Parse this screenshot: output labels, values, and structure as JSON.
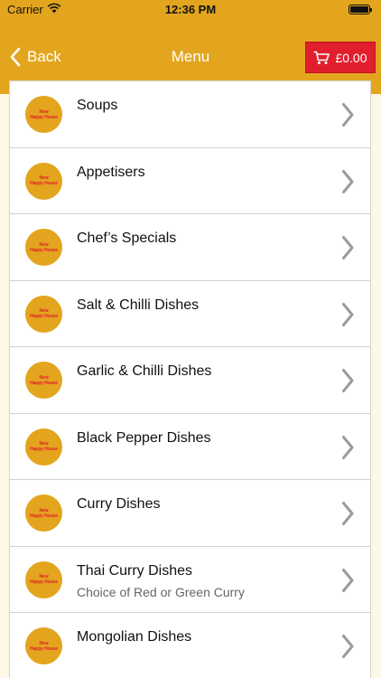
{
  "status_bar": {
    "carrier": "Carrier",
    "time": "12:36 PM",
    "icons": [
      "wifi-icon",
      "battery-icon"
    ]
  },
  "nav": {
    "back_label": "Back",
    "title": "Menu",
    "cart_total": "£0.00"
  },
  "logo_text": [
    "New",
    "Happy House"
  ],
  "colors": {
    "header": "#e3a51e",
    "cart_button": "#e01e2d",
    "background": "#fdf7e6",
    "logo_text": "#e0202a"
  },
  "categories": [
    {
      "title": "Soups",
      "subtitle": ""
    },
    {
      "title": "Appetisers",
      "subtitle": ""
    },
    {
      "title": "Chef’s Specials",
      "subtitle": ""
    },
    {
      "title": "Salt & Chilli Dishes",
      "subtitle": ""
    },
    {
      "title": "Garlic & Chilli Dishes",
      "subtitle": ""
    },
    {
      "title": "Black Pepper Dishes",
      "subtitle": ""
    },
    {
      "title": "Curry Dishes",
      "subtitle": ""
    },
    {
      "title": "Thai Curry Dishes",
      "subtitle": "Choice of Red or Green Curry"
    },
    {
      "title": "Mongolian Dishes",
      "subtitle": ""
    }
  ]
}
